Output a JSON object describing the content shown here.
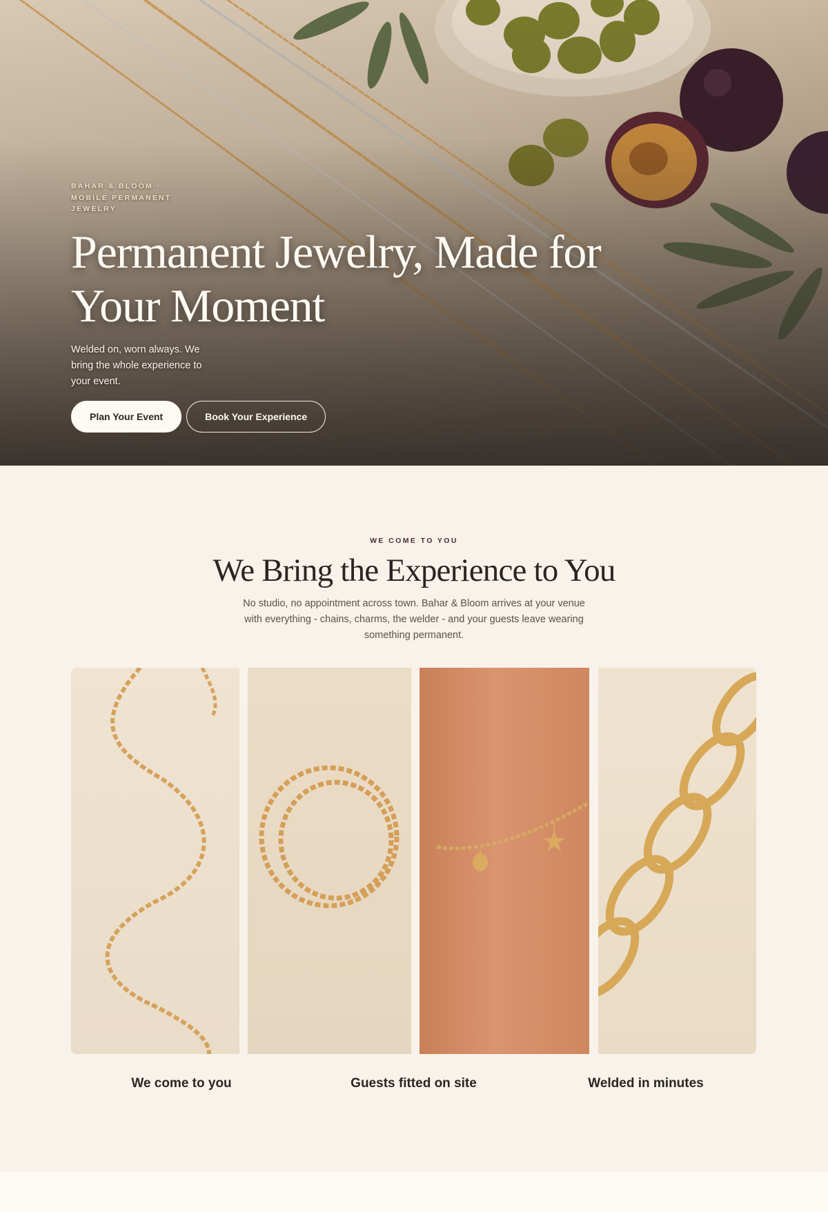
{
  "hero": {
    "eyebrow": "BAHAR & BLOOM · MOBILE PERMANENT JEWELRY",
    "title": "Permanent Jewelry, Made for Your Moment",
    "subtitle": "Welded on, worn always. We bring the whole experience to your event.",
    "primary_button": "Plan Your Event",
    "secondary_button": "Book Your Experience"
  },
  "experience": {
    "kicker": "WE COME TO YOU",
    "title": "We Bring the Experience to You",
    "description": "No studio, no appointment across town. Bahar & Bloom arrives at your venue with everything - chains, charms, the welder - and your guests leave wearing something permanent.",
    "features": [
      {
        "label": "We come to you"
      },
      {
        "label": "Guests fitted on site"
      },
      {
        "label": "Welded in minutes"
      }
    ]
  },
  "colors": {
    "cream": "#f8f2ea",
    "dark": "#2a2522",
    "gold": "#d4a159",
    "accent": "#4a2d33"
  }
}
